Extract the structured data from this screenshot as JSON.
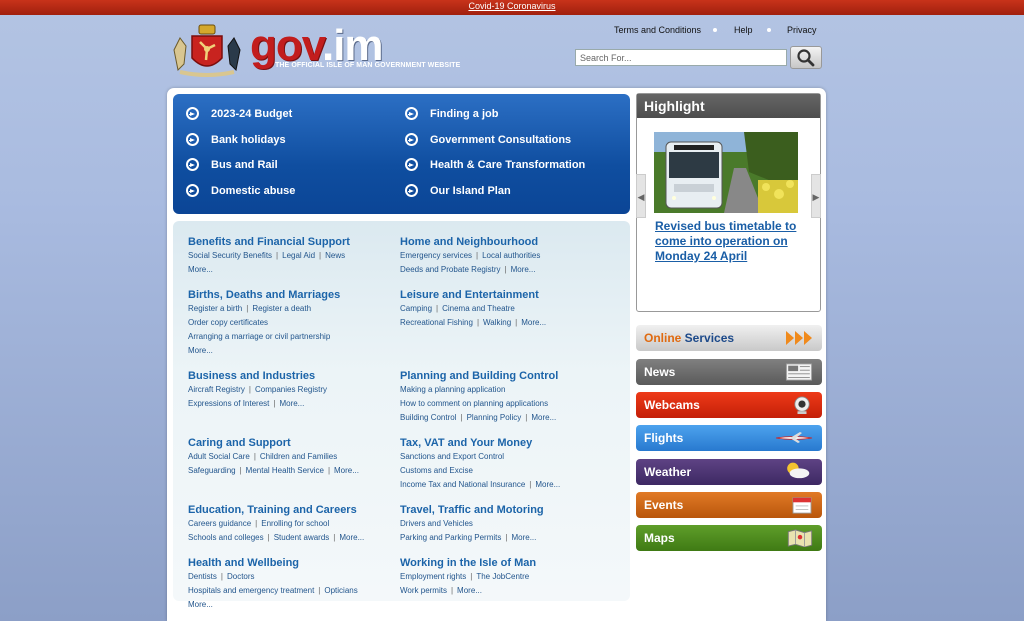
{
  "alert": {
    "text": "Covid-19 Coronavirus"
  },
  "header": {
    "logo_main": "gov",
    "logo_dot": ".",
    "logo_suffix": "im",
    "tagline": "THE OFFICIAL ISLE OF MAN GOVERNMENT WEBSITE",
    "links": [
      "Terms and Conditions",
      "Help",
      "Privacy"
    ],
    "search_placeholder": "Search For..."
  },
  "quick_links": [
    {
      "label": "2023-24 Budget"
    },
    {
      "label": "Bank holidays"
    },
    {
      "label": "Bus and Rail"
    },
    {
      "label": "Domestic abuse"
    },
    {
      "label": "Finding a job"
    },
    {
      "label": "Government Consultations"
    },
    {
      "label": "Health & Care Transformation"
    },
    {
      "label": "Our Island Plan"
    }
  ],
  "topics": [
    {
      "title": "Benefits and Financial Support",
      "lines": [
        [
          "Social Security Benefits",
          "Legal Aid",
          "News"
        ],
        [
          "More..."
        ]
      ]
    },
    {
      "title": "Births, Deaths and Marriages",
      "lines": [
        [
          "Register a birth",
          "Register a death"
        ],
        [
          "Order copy certificates"
        ],
        [
          "Arranging a marriage or civil partnership"
        ],
        [
          "More..."
        ]
      ]
    },
    {
      "title": "Business and Industries",
      "lines": [
        [
          "Aircraft Registry",
          "Companies Registry"
        ],
        [
          "Expressions of Interest",
          "More..."
        ]
      ]
    },
    {
      "title": "Caring and Support",
      "lines": [
        [
          "Adult Social Care",
          "Children and Families"
        ],
        [
          "Safeguarding",
          "Mental Health Service",
          "More..."
        ]
      ]
    },
    {
      "title": "Education, Training and Careers",
      "lines": [
        [
          "Careers guidance",
          "Enrolling for school"
        ],
        [
          "Schools and colleges",
          "Student awards",
          "More..."
        ]
      ]
    },
    {
      "title": "Health and Wellbeing",
      "lines": [
        [
          "Dentists",
          "Doctors"
        ],
        [
          "Hospitals and emergency treatment",
          "Opticians"
        ],
        [
          "More..."
        ]
      ]
    },
    {
      "title": "Home and Neighbourhood",
      "lines": [
        [
          "Emergency services",
          "Local authorities"
        ],
        [
          "Deeds and Probate Registry",
          "More..."
        ]
      ]
    },
    {
      "title": "Leisure and Entertainment",
      "lines": [
        [
          "Camping",
          "Cinema and Theatre"
        ],
        [
          "Recreational Fishing",
          "Walking",
          "More..."
        ]
      ]
    },
    {
      "title": "Planning and Building Control",
      "lines": [
        [
          "Making a planning application"
        ],
        [
          "How to comment on planning applications"
        ],
        [
          "Building Control",
          "Planning Policy",
          "More..."
        ]
      ]
    },
    {
      "title": "Tax, VAT and Your Money",
      "lines": [
        [
          "Sanctions and Export Control"
        ],
        [
          "Customs and Excise"
        ],
        [
          "Income Tax and National Insurance",
          "More..."
        ]
      ]
    },
    {
      "title": "Travel, Traffic and Motoring",
      "lines": [
        [
          "Drivers and Vehicles"
        ],
        [
          "Parking and Parking Permits",
          "More..."
        ]
      ]
    },
    {
      "title": "Working in the Isle of Man",
      "lines": [
        [
          "Employment rights",
          "The JobCentre"
        ],
        [
          "Work permits",
          "More..."
        ]
      ]
    }
  ],
  "highlight": {
    "heading": "Highlight",
    "caption": "Revised bus timetable to come into operation on Monday 24 April"
  },
  "services": [
    {
      "label_a": "Online",
      "label_b": " Services",
      "icon": "chevrons-icon",
      "color": "#d9d9d9"
    },
    {
      "label_a": "News",
      "label_b": "",
      "icon": "newspaper-icon",
      "color": "#6f6f6f"
    },
    {
      "label_a": "Webcams",
      "label_b": "",
      "icon": "webcam-icon",
      "color": "#d92a10"
    },
    {
      "label_a": "Flights",
      "label_b": "",
      "icon": "plane-icon",
      "color": "#3a8de0"
    },
    {
      "label_a": "Weather",
      "label_b": "",
      "icon": "weather-icon",
      "color": "#4b3470"
    },
    {
      "label_a": "Events",
      "label_b": "",
      "icon": "calendar-icon",
      "color": "#d2691b"
    },
    {
      "label_a": "Maps",
      "label_b": "",
      "icon": "map-icon",
      "color": "#4f8a1f"
    }
  ]
}
